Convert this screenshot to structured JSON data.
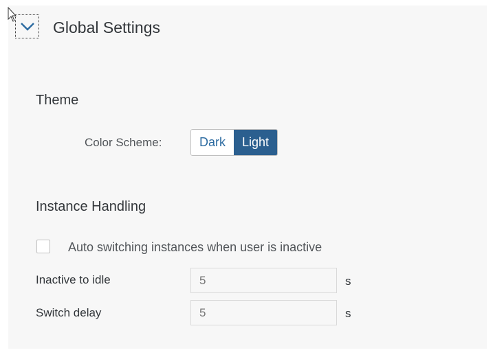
{
  "section": {
    "title": "Global Settings",
    "toggle_icon": "chevron-down-icon",
    "expanded": true
  },
  "theme": {
    "title": "Theme",
    "color_scheme_label": "Color Scheme:",
    "options": [
      "Dark",
      "Light"
    ],
    "selected": "Light"
  },
  "instance_handling": {
    "title": "Instance Handling",
    "auto_switch_label": "Auto switching instances when user is inactive",
    "auto_switch_checked": false,
    "inactive_to_idle": {
      "label": "Inactive to idle",
      "placeholder": "5",
      "unit": "s"
    },
    "switch_delay": {
      "label": "Switch delay",
      "placeholder": "5",
      "unit": "s"
    }
  },
  "colors": {
    "accent": "#2b5f8f",
    "link": "#2b6aa0",
    "panel_bg": "#f7f7f7"
  }
}
